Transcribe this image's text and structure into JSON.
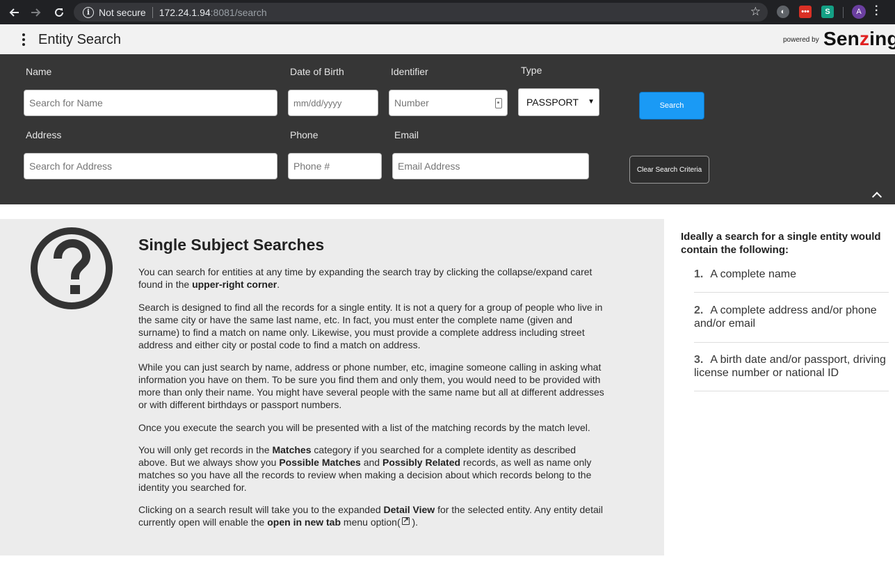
{
  "browser": {
    "security_label": "Not secure",
    "url_host": "172.24.1.94",
    "url_rest": ":8081/search",
    "avatar_letter": "A"
  },
  "header": {
    "title": "Entity Search",
    "powered_by": "powered by",
    "brand_pre": "Sen",
    "brand_z": "z",
    "brand_post": "ing"
  },
  "search": {
    "name_label": "Name",
    "name_placeholder": "Search for Name",
    "dob_label": "Date of Birth",
    "dob_placeholder": "mm/dd/yyyy",
    "identifier_label": "Identifier",
    "identifier_placeholder": "Number",
    "type_label": "Type",
    "type_value": "PASSPORT",
    "search_button": "Search",
    "address_label": "Address",
    "address_placeholder": "Search for Address",
    "phone_label": "Phone",
    "phone_placeholder": "Phone #",
    "email_label": "Email",
    "email_placeholder": "Email Address",
    "clear_button": "Clear Search Criteria"
  },
  "help": {
    "title": "Single Subject Searches",
    "p1_a": "You can search for entities at any time by expanding the search tray by clicking the collapse/expand caret found in the ",
    "p1_b": "upper-right corner",
    "p1_c": ".",
    "p2": "Search is designed to find all the records for a single entity. It is not a query for a group of people who live in the same city or have the same last name, etc. In fact, you must enter the complete name (given and surname) to find a match on name only. Likewise, you must provide a complete address including street address and either city or postal code to find a match on address.",
    "p3": "While you can just search by name, address or phone number, etc, imagine someone calling in asking what information you have on them. To be sure you find them and only them, you would need to be provided with more than only their name. You might have several people with the same name but all at different addresses or with different birthdays or passport numbers.",
    "p4": "Once you execute the search you will be presented with a list of the matching records by the match level.",
    "p5_a": "You will only get records in the ",
    "p5_b": "Matches",
    "p5_c": " category if you searched for a complete identity as described above. But we always show you ",
    "p5_d": "Possible Matches",
    "p5_e": " and ",
    "p5_f": "Possibly Related",
    "p5_g": " records, as well as name only matches so you have all the records to review when making a decision about which records belong to the identity you searched for.",
    "p6_a": "Clicking on a search result will take you to the expanded ",
    "p6_b": "Detail View",
    "p6_c": " for the selected entity. Any entity detail currently open will enable the ",
    "p6_d": "open in new tab",
    "p6_e": " menu option(",
    "p6_f": ")."
  },
  "sidebar": {
    "heading": "Ideally a search for a single entity would contain the following:",
    "items": [
      {
        "num": "1.",
        "text": "A complete name"
      },
      {
        "num": "2.",
        "text": "A complete address and/or phone and/or email"
      },
      {
        "num": "3.",
        "text": "A birth date and/or passport, driving license number or national ID"
      }
    ]
  }
}
